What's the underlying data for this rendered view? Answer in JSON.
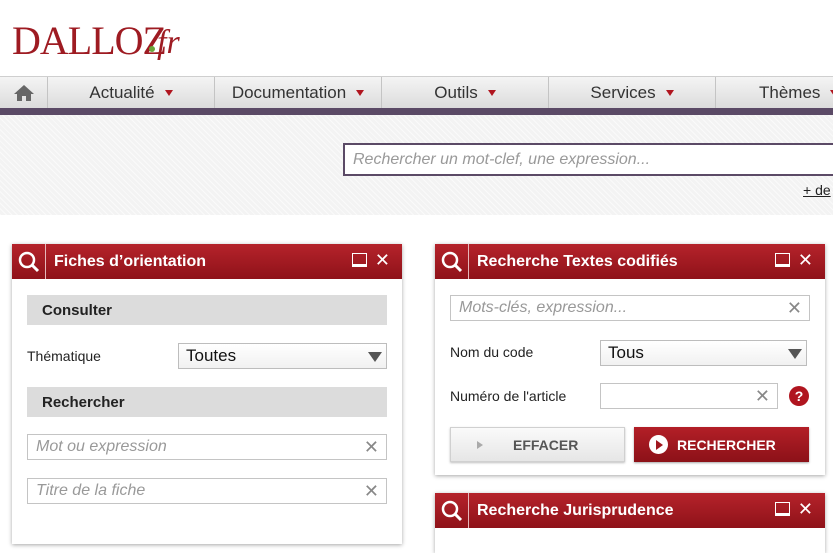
{
  "logo": {
    "brand": "DALLOZ",
    "suffix": "fr"
  },
  "nav": {
    "home_icon": "home-icon",
    "items": [
      {
        "label": "Actualité"
      },
      {
        "label": "Documentation"
      },
      {
        "label": "Outils"
      },
      {
        "label": "Services"
      },
      {
        "label": "Thèmes"
      }
    ]
  },
  "search": {
    "placeholder": "Rechercher un mot-clef, une expression...",
    "more_link": "+ de"
  },
  "widgets": {
    "fiches": {
      "title": "Fiches d’orientation",
      "consulter": "Consulter",
      "thematique_label": "Thématique",
      "thematique_value": "Toutes",
      "rechercher": "Rechercher",
      "mot_placeholder": "Mot ou expression",
      "titre_placeholder": "Titre de la fiche"
    },
    "textes": {
      "title": "Recherche Textes codifiés",
      "keywords_placeholder": "Mots-clés, expression...",
      "code_label": "Nom du code",
      "code_value": "Tous",
      "article_label": "Numéro de l'article",
      "help": "?",
      "clear_label": "EFFACER",
      "search_label": "RECHERCHER"
    },
    "juris": {
      "title": "Recherche Jurisprudence"
    }
  },
  "colors": {
    "brand_red": "#9e1b22",
    "accent_purple": "#5b4a66",
    "logo_dot": "#6aa53a"
  }
}
